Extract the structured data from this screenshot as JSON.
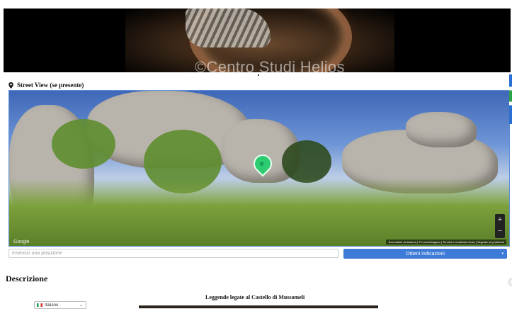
{
  "hero": {
    "watermark": "©Centro Studi Helios"
  },
  "street_view": {
    "title": "Street View (se presente)",
    "google_logo": "Google",
    "terms": "Scorciatoie da tastiera | © Luca Mangano | Termini e condizioni d'uso | Segnala un problema",
    "zoom_in": "+",
    "zoom_out": "−"
  },
  "directions": {
    "input_placeholder": "Inserisci una posizione",
    "button_label": "Ottieni indicazioni",
    "button_caret": "▾"
  },
  "description": {
    "title": "Descrizione",
    "subtitle": "Leggende legate al Castello di Mussomeli"
  },
  "language": {
    "selected": "Italiano",
    "chevron": "⌄"
  },
  "colors": {
    "accent": "#3e7ad8",
    "marker": "#2ecc71"
  }
}
